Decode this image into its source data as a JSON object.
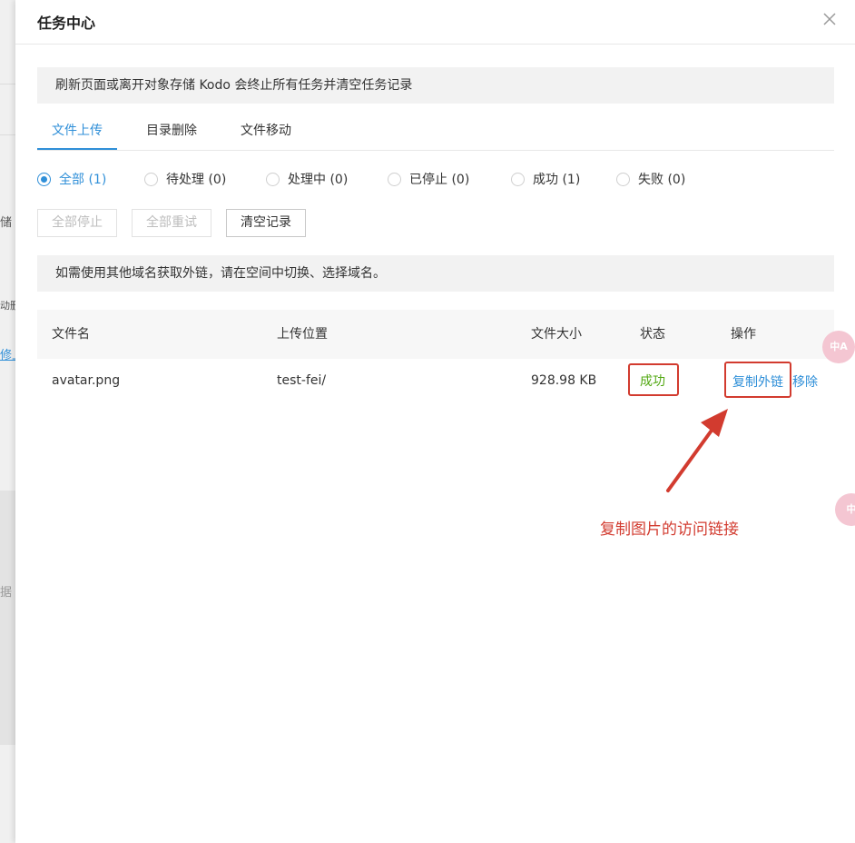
{
  "background": {
    "fragments": [
      "储",
      "动删",
      "修上",
      "据"
    ]
  },
  "modal": {
    "title": "任务中心",
    "close_icon": "close-icon",
    "notice": "刷新页面或离开对象存储 Kodo 会终止所有任务并清空任务记录",
    "tabs": [
      {
        "label": "文件上传",
        "active": true
      },
      {
        "label": "目录删除",
        "active": false
      },
      {
        "label": "文件移动",
        "active": false
      }
    ],
    "filters": [
      {
        "label": "全部 (1)",
        "checked": true
      },
      {
        "label": "待处理 (0)",
        "checked": false
      },
      {
        "label": "处理中 (0)",
        "checked": false
      },
      {
        "label": "已停止 (0)",
        "checked": false
      },
      {
        "label": "成功 (1)",
        "checked": false
      },
      {
        "label": "失败 (0)",
        "checked": false
      }
    ],
    "buttons": {
      "stop_all": "全部停止",
      "retry_all": "全部重试",
      "clear": "清空记录"
    },
    "tip": "如需使用其他域名获取外链，请在空间中切换、选择域名。",
    "table": {
      "headers": [
        "文件名",
        "上传位置",
        "文件大小",
        "状态",
        "操作"
      ],
      "rows": [
        {
          "name": "avatar.png",
          "location": "test-fei/",
          "size": "928.98 KB",
          "status": "成功",
          "actions": {
            "copy_link": "复制外链",
            "remove": "移除"
          }
        }
      ]
    }
  },
  "annotation": {
    "text": "复制图片的访问链接",
    "color": "#d23b2f"
  },
  "side_widgets": [
    {
      "icon": "translate-icon",
      "label": "中A"
    },
    {
      "icon": "translate-icon",
      "label": "中"
    }
  ],
  "colors": {
    "accent": "#2f8fd8",
    "success": "#52a812",
    "highlight": "#d23b2f"
  }
}
